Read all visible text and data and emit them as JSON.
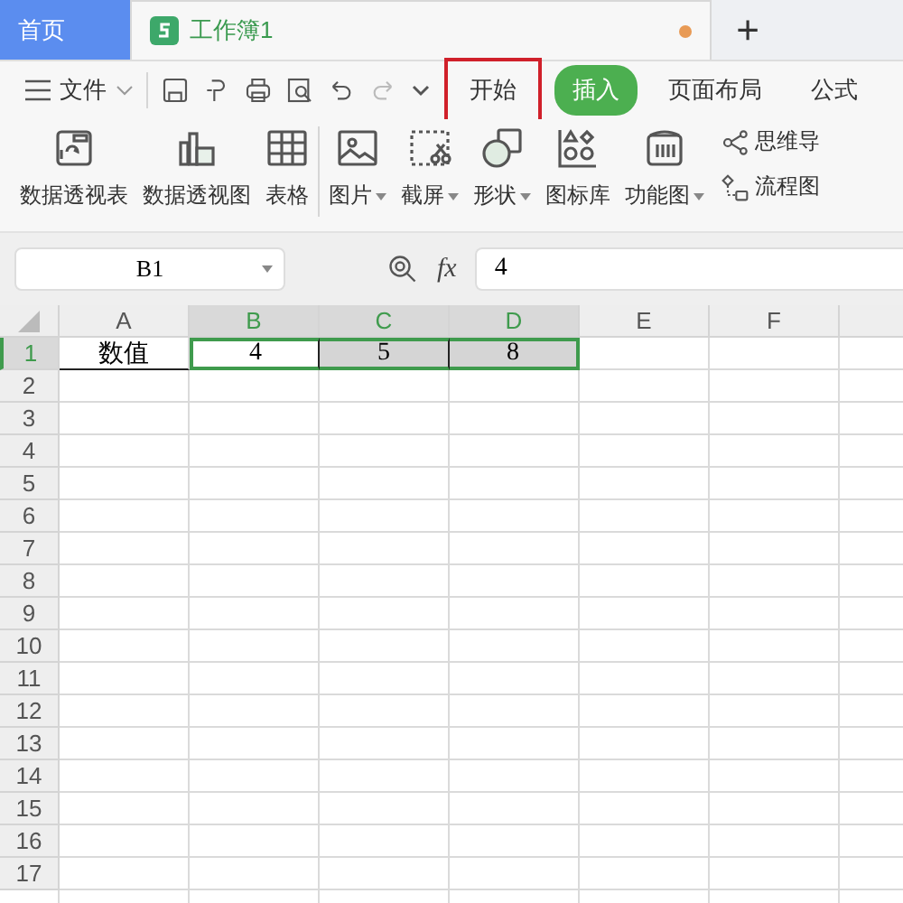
{
  "tabs": [
    {
      "label": "首页",
      "kind": "home",
      "selected": false
    },
    {
      "label": "工作簿1",
      "kind": "document",
      "selected": true,
      "unsaved": true
    }
  ],
  "new_tab": "+",
  "menu": {
    "file": "文件",
    "ribbon_tabs": [
      {
        "label": "开始",
        "selected": false,
        "highlighted": true
      },
      {
        "label": "插入",
        "selected": true,
        "highlighted": false
      },
      {
        "label": "页面布局",
        "selected": false,
        "highlighted": false
      },
      {
        "label": "公式",
        "selected": false,
        "highlighted": false
      }
    ]
  },
  "ribbon_groups": [
    {
      "tools": [
        {
          "label": "数据透视表",
          "kind": "pivot-table",
          "dropdown": false
        },
        {
          "label": "数据透视图",
          "kind": "pivot-chart",
          "dropdown": false
        },
        {
          "label": "表格",
          "kind": "table",
          "dropdown": false
        }
      ]
    },
    {
      "tools": [
        {
          "label": "图片",
          "kind": "picture",
          "dropdown": true
        },
        {
          "label": "截屏",
          "kind": "screenshot",
          "dropdown": true
        },
        {
          "label": "形状",
          "kind": "shapes",
          "dropdown": true
        },
        {
          "label": "图标库",
          "kind": "icons",
          "dropdown": false
        },
        {
          "label": "功能图",
          "kind": "function",
          "dropdown": true
        }
      ]
    }
  ],
  "ribbon_small": [
    {
      "label": "思维导",
      "kind": "mindmap"
    },
    {
      "label": "流程图",
      "kind": "flowchart"
    }
  ],
  "formula_bar": {
    "name_box": "B1",
    "fx": "fx",
    "value": "4"
  },
  "grid": {
    "columns": [
      {
        "label": "A",
        "selected": false
      },
      {
        "label": "B",
        "selected": true
      },
      {
        "label": "C",
        "selected": true
      },
      {
        "label": "D",
        "selected": true
      },
      {
        "label": "E",
        "selected": false
      },
      {
        "label": "F",
        "selected": false
      }
    ],
    "rows": [
      {
        "label": "1",
        "selected": true,
        "cells": [
          {
            "text": "数值",
            "selected": false
          },
          {
            "text": "4",
            "selected": true
          },
          {
            "text": "5",
            "selected": true
          },
          {
            "text": "8",
            "selected": true
          }
        ]
      },
      {
        "label": "2",
        "selected": false,
        "cells": []
      },
      {
        "label": "3",
        "selected": false,
        "cells": []
      },
      {
        "label": "4",
        "selected": false,
        "cells": []
      },
      {
        "label": "5",
        "selected": false,
        "cells": []
      },
      {
        "label": "6",
        "selected": false,
        "cells": []
      },
      {
        "label": "7",
        "selected": false,
        "cells": []
      },
      {
        "label": "8",
        "selected": false,
        "cells": []
      },
      {
        "label": "9",
        "selected": false,
        "cells": []
      },
      {
        "label": "10",
        "selected": false,
        "cells": []
      },
      {
        "label": "11",
        "selected": false,
        "cells": []
      },
      {
        "label": "12",
        "selected": false,
        "cells": []
      },
      {
        "label": "13",
        "selected": false,
        "cells": []
      },
      {
        "label": "14",
        "selected": false,
        "cells": []
      },
      {
        "label": "15",
        "selected": false,
        "cells": []
      },
      {
        "label": "16",
        "selected": false,
        "cells": []
      },
      {
        "label": "17",
        "selected": false,
        "cells": []
      }
    ]
  }
}
